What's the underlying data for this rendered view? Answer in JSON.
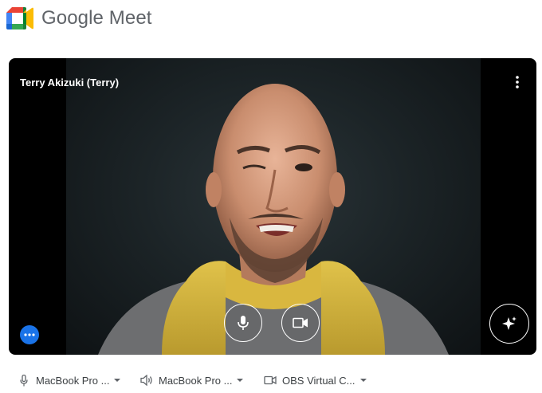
{
  "header": {
    "brand_word": "Google",
    "product_word": "Meet",
    "logo_icon": "google-meet-logo"
  },
  "preview": {
    "participant_name": "Terry Akizuki (Terry)",
    "more_icon": "more-vert-icon",
    "mic_icon": "microphone-icon",
    "camera_icon": "videocam-icon",
    "effects_icon": "sparkle-icon",
    "options_icon": "more-horiz-icon",
    "options_color": "#1a73e8"
  },
  "devices": {
    "microphone": "MacBook Pro ...",
    "speaker": "MacBook Pro ...",
    "camera": "OBS Virtual C..."
  }
}
